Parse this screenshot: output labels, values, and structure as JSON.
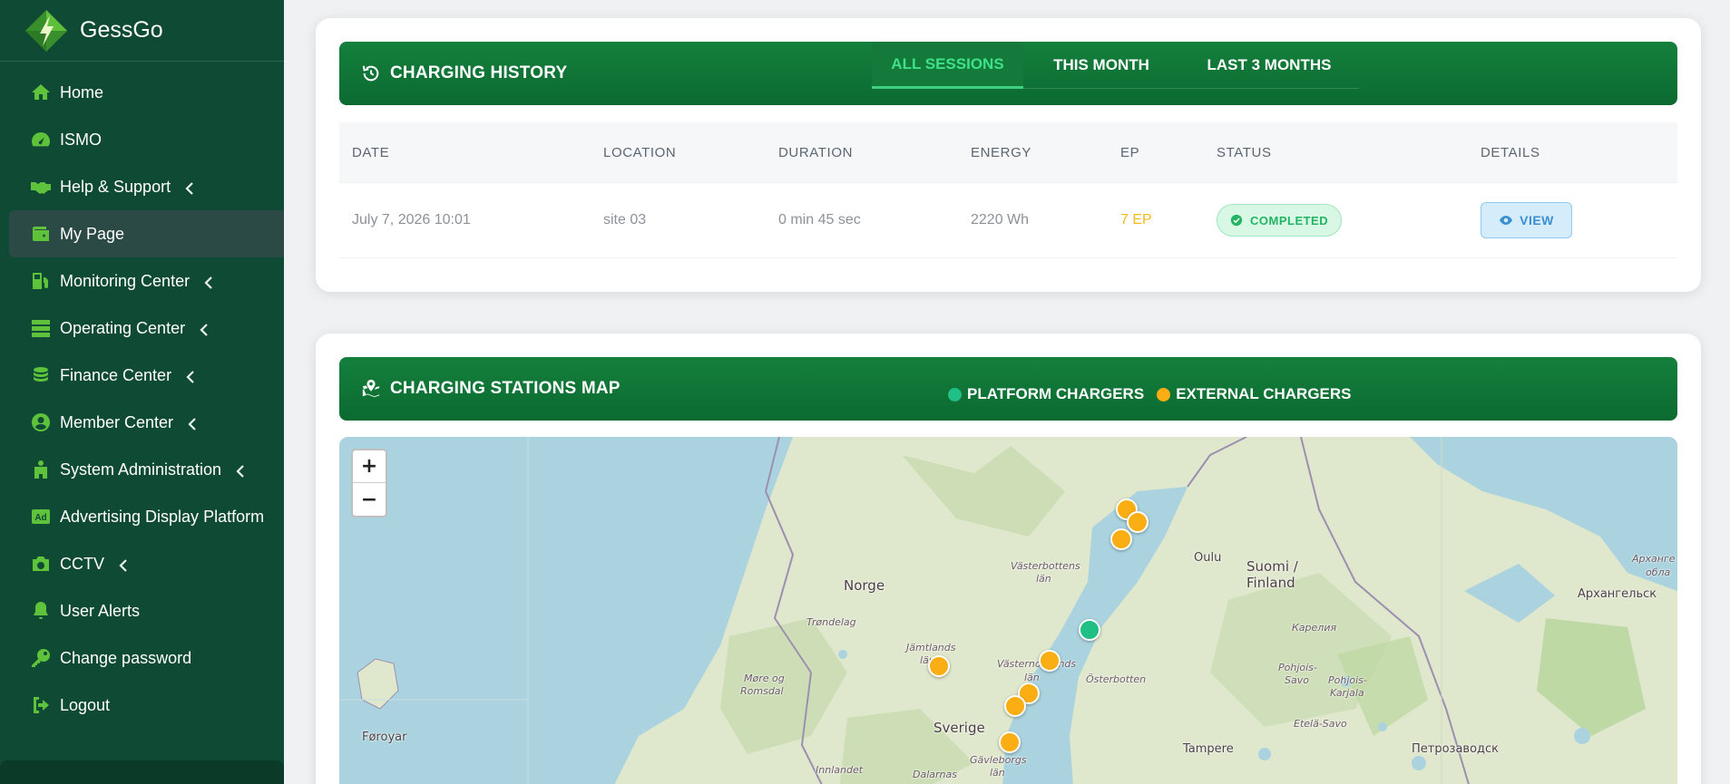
{
  "brand": {
    "name": "GessGo"
  },
  "sidebar": {
    "items": [
      {
        "label": "Home",
        "icon": "home-icon",
        "has_submenu": false
      },
      {
        "label": "ISMO",
        "icon": "gauge-icon",
        "has_submenu": false
      },
      {
        "label": "Help & Support",
        "icon": "handshake-icon",
        "has_submenu": true
      },
      {
        "label": "My Page",
        "icon": "wallet-icon",
        "has_submenu": false,
        "active": true
      },
      {
        "label": "Monitoring Center",
        "icon": "charging-station-icon",
        "has_submenu": true
      },
      {
        "label": "Operating Center",
        "icon": "server-icon",
        "has_submenu": true
      },
      {
        "label": "Finance Center",
        "icon": "coins-icon",
        "has_submenu": true
      },
      {
        "label": "Member Center",
        "icon": "user-circle-icon",
        "has_submenu": true
      },
      {
        "label": "System Administration",
        "icon": "building-icon",
        "has_submenu": true
      },
      {
        "label": "Advertising Display Platform",
        "icon": "ad-icon",
        "has_submenu": false
      },
      {
        "label": "CCTV",
        "icon": "camera-icon",
        "has_submenu": true
      },
      {
        "label": "User Alerts",
        "icon": "bell-icon",
        "has_submenu": false
      },
      {
        "label": "Change password",
        "icon": "key-icon",
        "has_submenu": false
      },
      {
        "label": "Logout",
        "icon": "logout-icon",
        "has_submenu": false
      }
    ]
  },
  "history": {
    "title": "CHARGING HISTORY",
    "tabs": [
      {
        "label": "ALL SESSIONS",
        "active": true
      },
      {
        "label": "THIS MONTH",
        "active": false
      },
      {
        "label": "LAST 3 MONTHS",
        "active": false
      }
    ],
    "columns": [
      "DATE",
      "LOCATION",
      "DURATION",
      "ENERGY",
      "EP",
      "STATUS",
      "DETAILS"
    ],
    "rows": [
      {
        "date": "July 7, 2026 10:01",
        "location": "site 03",
        "duration": "0 min 45 sec",
        "energy": "2220 Wh",
        "ep": "7 EP",
        "status": "COMPLETED",
        "action": "VIEW"
      }
    ]
  },
  "map": {
    "title": "CHARGING STATIONS MAP",
    "legend": [
      {
        "label": "PLATFORM CHARGERS",
        "color": "#1fbf85"
      },
      {
        "label": "EXTERNAL CHARGERS",
        "color": "#fbad14"
      }
    ],
    "zoom_in": "+",
    "zoom_out": "−",
    "labels": {
      "norge": "Norge",
      "suomi": "Suomi /",
      "finland": "Finland",
      "sverige": "Sverige",
      "oulu": "Oulu",
      "foroyar": "Føroyar",
      "tampere": "Tampere",
      "arkhangelsk": "Архангельск",
      "arkh_obl_1": "Архангe",
      "arkh_obl_2": "обла",
      "petrozavodsk": "Петрозаводск",
      "karelia": "Карелия",
      "vasterbotten_1": "Västerbottens",
      "vasterbotten_2": "län",
      "jamtland_1": "Jämtlands",
      "jamtland_2": "län",
      "vasternorrland_1": "Västernorrlands",
      "vasternorrland_2": "län",
      "gavleborg_1": "Gävleborgs",
      "gavleborg_2": "län",
      "trondelag": "Trøndelag",
      "more_1": "Møre og",
      "more_2": "Romsdal",
      "innlandet": "Innlandet",
      "dalarnas": "Dalarnas",
      "osterbotten": "Österbotten",
      "pohjois_savo_1": "Pohjois-",
      "pohjois_savo_2": "Savo",
      "pohjois_karjala_1": "Pohjois-",
      "pohjois_karjala_2": "Karjala",
      "etela_savo": "Etelä-Savo"
    }
  }
}
